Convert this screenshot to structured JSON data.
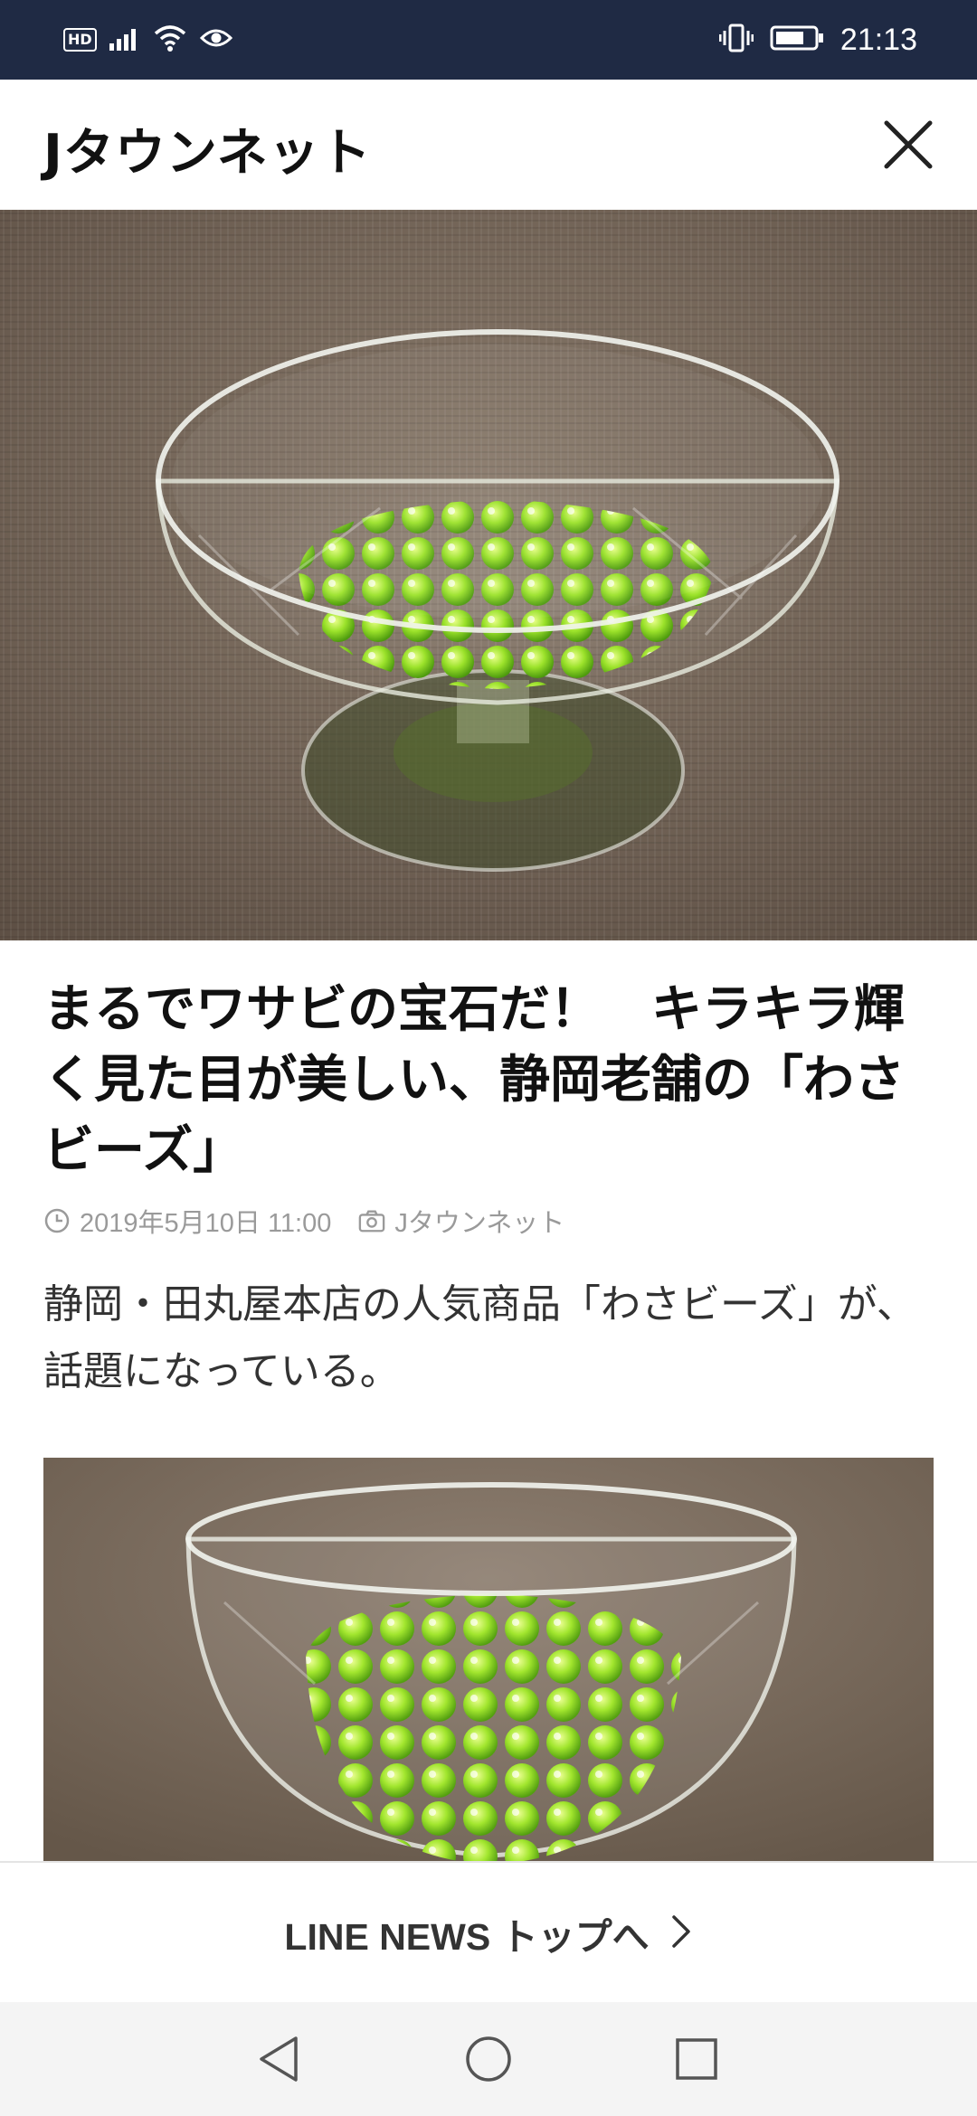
{
  "status_bar": {
    "badge": "HD",
    "time": "21:13",
    "icons": [
      "signal-icon",
      "wifi-icon",
      "eye-icon",
      "vibrate-icon",
      "battery-icon"
    ]
  },
  "header": {
    "title": "Jタウンネット",
    "close_icon": "close-icon"
  },
  "article": {
    "headline": "まるでワサビの宝石だ！　キラキラ輝く見た目が美しい、静岡老舗の「わさビーズ」",
    "date": "2019年5月10日 11:00",
    "source": "Jタウンネット",
    "lede": "静岡・田丸屋本店の人気商品「わさビーズ」が、話題になっている。"
  },
  "footer_link": {
    "label": "LINE NEWS トップへ",
    "icon": "chevron-right-icon"
  },
  "nav_bar": {
    "buttons": [
      "back-icon",
      "home-icon",
      "recents-icon"
    ]
  },
  "colors": {
    "status_bar": "#1f2a44",
    "meta_text": "#9a9a9a",
    "beads": "#9be22a",
    "tablecloth": "#7a6a5c"
  }
}
